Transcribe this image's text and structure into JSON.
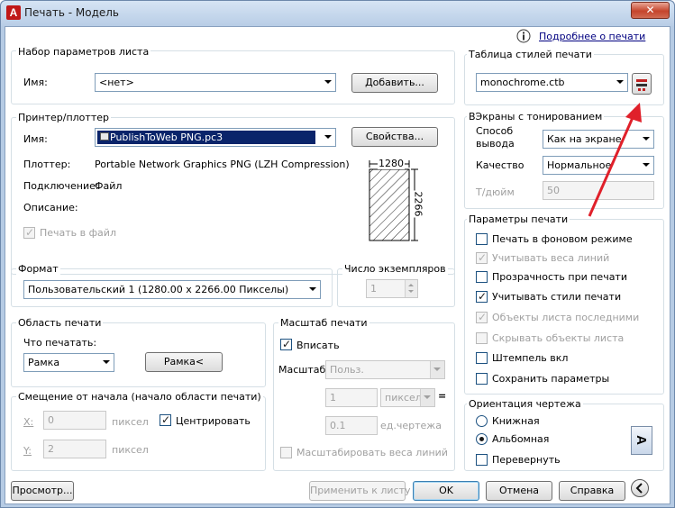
{
  "window": {
    "app_icon": "A",
    "title": "Печать - Модель",
    "close": "✕",
    "help_link": "Подробнее о печати",
    "help_icon": "info-icon"
  },
  "page_setup": {
    "legend": "Набор параметров листа",
    "name_label": "Имя:",
    "name_value": "<нет>",
    "add_button": "Добавить..."
  },
  "printer": {
    "legend": "Принтер/плоттер",
    "name_label": "Имя:",
    "name_value": "PublishToWeb PNG.pc3",
    "properties_button": "Свойства...",
    "plotter_label": "Плоттер:",
    "plotter_value": "Portable Network Graphics PNG (LZH Compression) - ...",
    "connection_label": "Подключение:",
    "connection_value": "Файл",
    "description_label": "Описание:",
    "print_to_file": "Печать в файл",
    "preview_width": "1280",
    "preview_height": "2266"
  },
  "format": {
    "legend": "Формат",
    "value": "Пользовательский 1 (1280.00 x 2266.00 Пикселы)"
  },
  "copies": {
    "legend": "Число экземпляров",
    "value": "1"
  },
  "area": {
    "legend": "Область печати",
    "what_label": "Что печатать:",
    "what_value": "Рамка",
    "frame_button": "Рамка<"
  },
  "offset": {
    "legend": "Смещение от начала (начало области печати)",
    "x_label": "X:",
    "x_value": "0",
    "x_unit": "пиксел",
    "y_label": "Y:",
    "y_value": "2",
    "y_unit": "пиксел",
    "center": "Центрировать"
  },
  "scale": {
    "legend": "Масштаб печати",
    "fit": "Вписать",
    "scale_label": "Масштаб:",
    "scale_value": "Польз.",
    "value1": "1",
    "unit1": "пиксел",
    "equals": "=",
    "value2": "0.1",
    "unit2": "ед.чертежа",
    "lineweights": "Масштабировать веса линий"
  },
  "style_table": {
    "legend": "Таблица стилей печати",
    "value": "monochrome.ctb",
    "edit_icon": "edit-style-icon"
  },
  "shaded": {
    "legend": "ВЭкраны с тонированием",
    "method_label_1": "Способ",
    "method_label_2": "вывода",
    "method_value": "Как на экране",
    "quality_label": "Качество",
    "quality_value": "Нормальное",
    "dpi_label": "Т/дюйм",
    "dpi_value": "50"
  },
  "options": {
    "legend": "Параметры печати",
    "items": [
      {
        "label": "Печать в фоновом режиме",
        "checked": false,
        "enabled": true
      },
      {
        "label": "Учитывать веса линий",
        "checked": true,
        "enabled": false
      },
      {
        "label": "Прозрачность при печати",
        "checked": false,
        "enabled": true
      },
      {
        "label": "Учитывать стили печати",
        "checked": true,
        "enabled": true
      },
      {
        "label": "Объекты листа последними",
        "checked": true,
        "enabled": false
      },
      {
        "label": "Скрывать объекты листа",
        "checked": false,
        "enabled": false
      },
      {
        "label": "Штемпель вкл",
        "checked": false,
        "enabled": true
      },
      {
        "label": "Сохранить параметры",
        "checked": false,
        "enabled": true
      }
    ]
  },
  "orientation": {
    "legend": "Ориентация чертежа",
    "portrait": "Книжная",
    "landscape": "Альбомная",
    "flip": "Перевернуть",
    "selected": "landscape",
    "page_letter": "A"
  },
  "footer": {
    "preview": "Просмотр...",
    "apply": "Применить к листу",
    "ok": "OK",
    "cancel": "Отмена",
    "help": "Справка",
    "collapse_icon": "chevron-left-icon"
  },
  "colors": {
    "annotation_arrow": "#e0202a",
    "title_bg": "#b6cbe4"
  }
}
